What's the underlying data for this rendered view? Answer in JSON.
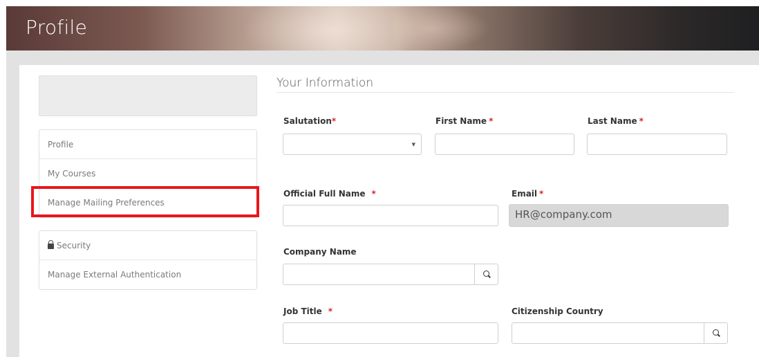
{
  "page_title": "Profile",
  "sidebar": {
    "items": [
      {
        "label": "Profile"
      },
      {
        "label": "My Courses"
      },
      {
        "label": "Manage Mailing Preferences"
      }
    ],
    "security_items": [
      {
        "label": "Security",
        "icon": "lock-icon"
      },
      {
        "label": "Manage External Authentication"
      }
    ]
  },
  "form": {
    "section_title": "Your Information",
    "required_marker": "*",
    "salutation": {
      "label": "Salutation",
      "required": true,
      "value": "",
      "caret": "▼"
    },
    "first_name": {
      "label": "First Name",
      "required": true,
      "value": ""
    },
    "last_name": {
      "label": "Last Name",
      "required": true,
      "value": ""
    },
    "official_full_name": {
      "label": "Official Full Name",
      "required": true,
      "value": ""
    },
    "email": {
      "label": "Email",
      "required": true,
      "value": "HR@company.com"
    },
    "company_name": {
      "label": "Company Name",
      "required": false,
      "value": ""
    },
    "job_title": {
      "label": "Job Title",
      "required": true,
      "value": ""
    },
    "citizenship_country": {
      "label": "Citizenship Country",
      "required": false,
      "value": ""
    }
  },
  "colors": {
    "required": "#d9262b",
    "highlight_box": "#e8161b",
    "disabled_field": "#d8d8d8"
  }
}
